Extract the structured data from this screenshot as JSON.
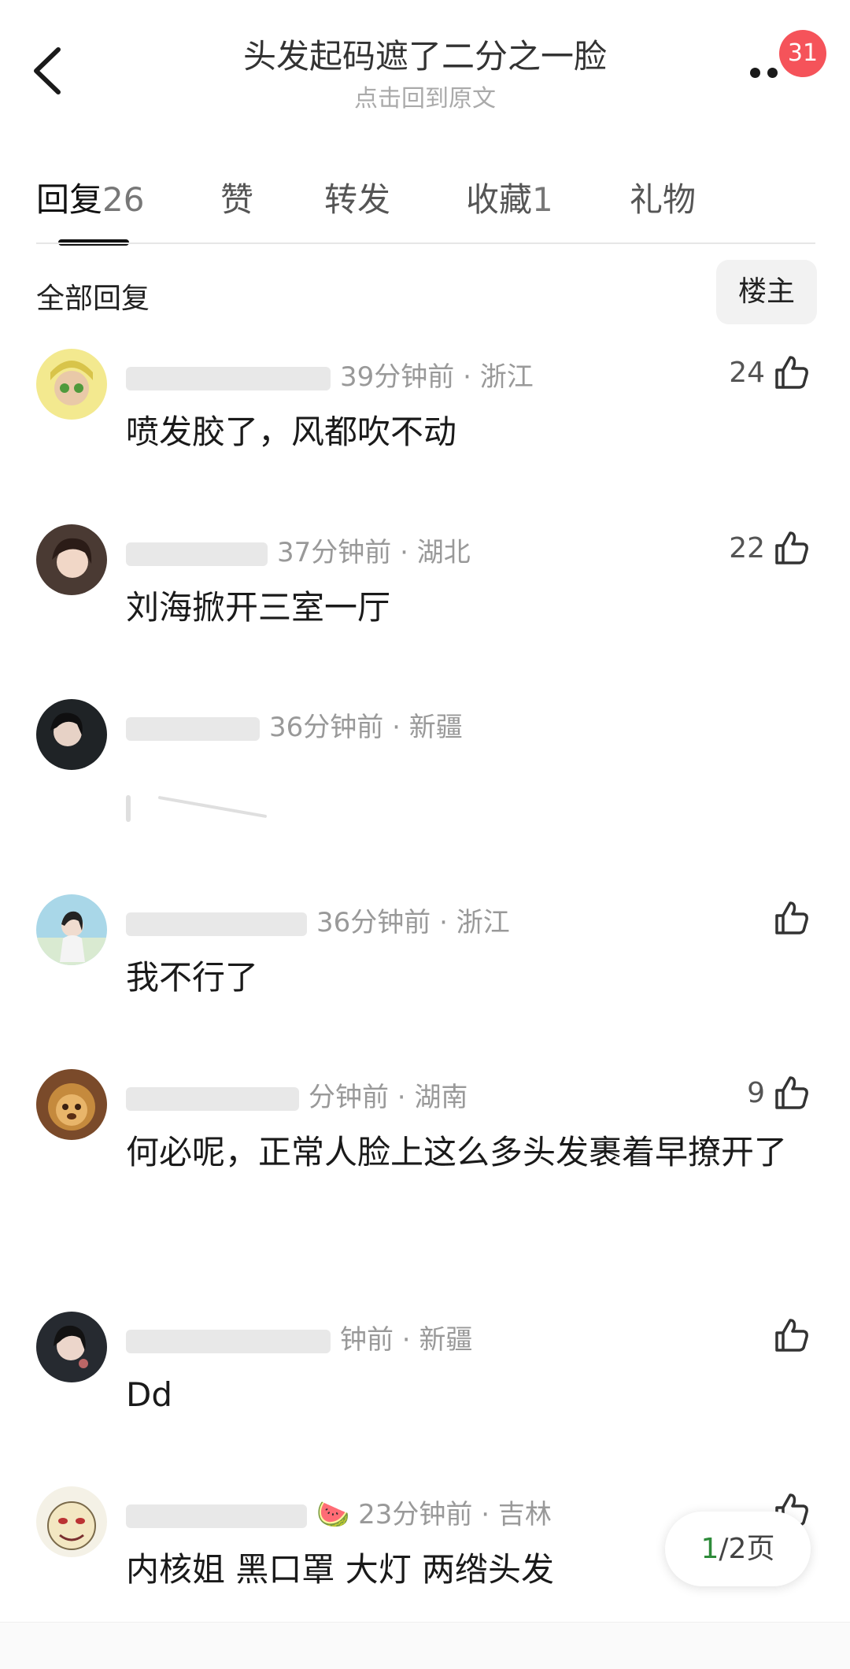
{
  "header": {
    "title": "头发起码遮了二分之一脸",
    "subtitle": "点击回到原文",
    "badge": "31"
  },
  "tabs": [
    {
      "label": "回复",
      "count": "26"
    },
    {
      "label": "赞",
      "count": ""
    },
    {
      "label": "转发",
      "count": ""
    },
    {
      "label": "收藏",
      "count": "1"
    },
    {
      "label": "礼物",
      "count": ""
    }
  ],
  "section": {
    "label": "全部回复",
    "filter_button": "楼主"
  },
  "comments": [
    {
      "time": "39分钟前",
      "location": "浙江",
      "likes": "24",
      "text": "喷发胶了，风都吹不动"
    },
    {
      "time": "37分钟前",
      "location": "湖北",
      "likes": "22",
      "text": "刘海掀开三室一厅"
    },
    {
      "time": "36分钟前",
      "location": "新疆",
      "likes": "",
      "text": ""
    },
    {
      "time": "36分钟前",
      "location": "浙江",
      "likes": "",
      "text": "我不行了"
    },
    {
      "time": "分钟前",
      "location": "湖南",
      "likes": "9",
      "text": "何必呢，正常人脸上这么多头发裹着早撩开了"
    },
    {
      "time": "钟前",
      "location": "新疆",
      "likes": "",
      "text": "Dd"
    },
    {
      "time": "23分钟前",
      "location": "吉林",
      "likes": "",
      "text": "内核姐 黑口罩 大灯 两绺头发"
    }
  ],
  "pager": {
    "current": "1",
    "total_label": "/2页"
  },
  "icons": {
    "back": "chevron-left-icon",
    "more": "more-dots-icon",
    "like": "thumbs-up-icon"
  },
  "colors": {
    "badge": "#f5535a",
    "pager_current": "#2e8b3a"
  }
}
